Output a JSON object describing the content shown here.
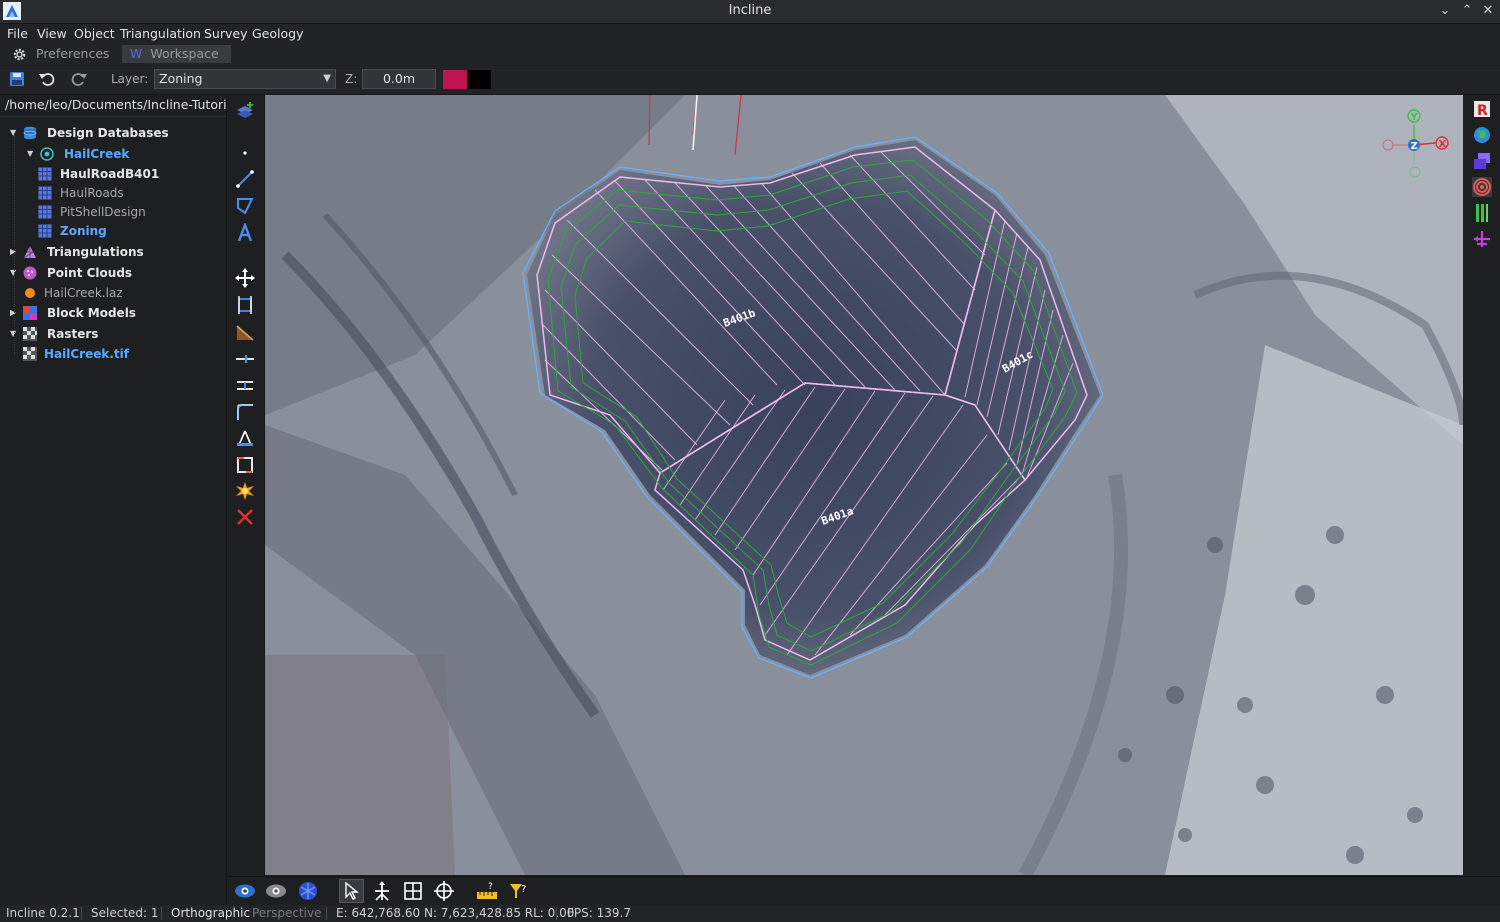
{
  "window": {
    "title": "Incline",
    "controls": [
      "chevron-down-icon",
      "chevron-up-icon",
      "close-icon"
    ]
  },
  "menu": [
    "File",
    "View",
    "Object",
    "Triangulation",
    "Survey",
    "Geology"
  ],
  "tabs": {
    "preferences": "Preferences",
    "workspace_badge": "W",
    "workspace": "Workspace"
  },
  "toolbar": {
    "layer_label": "Layer:",
    "layer_value": "Zoning",
    "z_label": "Z:",
    "z_value": "0.0m",
    "color_primary": "#c0134f",
    "color_secondary": "#000000"
  },
  "tree": {
    "path": "/home/leo/Documents/Incline-Tutori...",
    "design_databases": "Design Databases",
    "hailcreek": "HailCreek",
    "items": [
      "HaulRoadB401",
      "HaulRoads",
      "PitShellDesign",
      "Zoning"
    ],
    "triangulations": "Triangulations",
    "point_clouds": "Point Clouds",
    "laz": "HailCreek.laz",
    "block_models": "Block Models",
    "rasters": "Rasters",
    "tif": "HailCreek.tif"
  },
  "viewport": {
    "labels": [
      "B401b",
      "B401c",
      "B401a"
    ],
    "axes": {
      "y": "Y",
      "z": "Z",
      "x": "X"
    }
  },
  "status": {
    "version": "Incline 0.2.1",
    "selected": "Selected: 1",
    "ortho": "Orthographic",
    "perspective": "Perspective",
    "coords": "E: 642,768.60 N: 7,623,428.85 RL: 0.00",
    "fps": "FPS: 139.7"
  },
  "colors": {
    "accent_blue": "#5aa9ff",
    "zone_outline": "#f0b8f0",
    "contour_green": "#2fa83a",
    "pit_outline_blue": "#6ab0ff"
  }
}
